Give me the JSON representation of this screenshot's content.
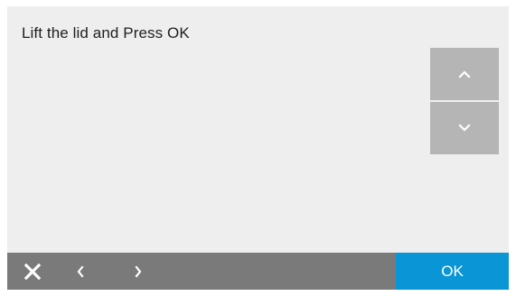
{
  "prompt": {
    "message": "Lift the lid and Press OK"
  },
  "scroll": {
    "up_icon": "chevron-up-icon",
    "down_icon": "chevron-down-icon"
  },
  "bottom_bar": {
    "close_icon": "close-icon",
    "back_icon": "chevron-left-icon",
    "forward_icon": "chevron-right-icon",
    "ok_label": "OK"
  },
  "colors": {
    "screen_background": "#eeeeee",
    "scroll_button": "#b5b5b5",
    "bottom_bar": "#7a7a7a",
    "ok_button": "#0a96d6",
    "text": "#1e1e1e"
  }
}
